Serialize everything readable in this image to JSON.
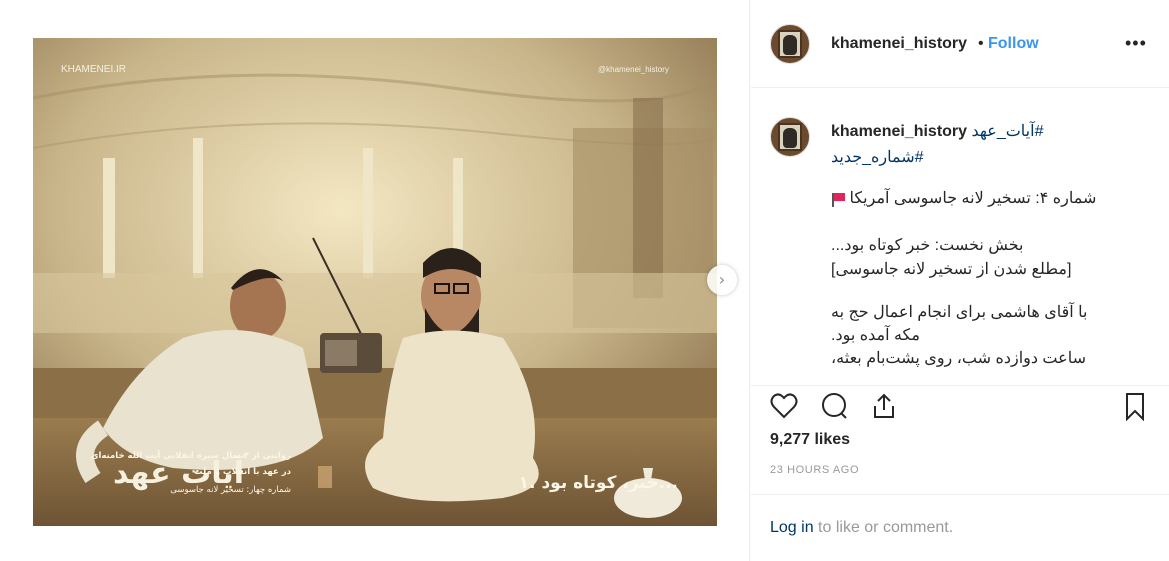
{
  "post": {
    "image_alt": "Illustration: two men seated on a rooftop, radio and tea cups; caption text in Persian",
    "image_text": {
      "logo": "KHAMENEI.IR",
      "handle": "@khamenei_history",
      "title_art": "آیات عهد",
      "subtitle_line1": "روایتی از ۴ سال سیره انقلابی آیت الله خامنه‌ای",
      "subtitle_line2": "در عهد با انقلاب و ملت",
      "subtitle_line3": "شماره چهار: تسخیر لانه جاسوسی",
      "chapter": "۱. خبر، کوتاه بود..."
    },
    "next_arrow": "›"
  },
  "header": {
    "username": "khamenei_history",
    "separator": "•",
    "follow_label": "Follow",
    "more_label": "•••"
  },
  "caption": {
    "username": "khamenei_history",
    "hashtag1": "#آیات_عهد",
    "hashtag2": "#شماره_جدید",
    "line1": "شماره ۴: تسخیر لانه جاسوسی آمریکا",
    "line2": "بخش نخست: خبر کوتاه بود...",
    "line3": "[مطلع شدن از تسخیر لانه جاسوسی]",
    "line4": "با آقای هاشمی برای انجام اعمال حج به",
    "line5": "مکه آمده بود.",
    "line6": "ساعت دوازده شب، روی پشت‌بام بعثه،"
  },
  "actions": {
    "like_icon": "heart-icon",
    "comment_icon": "comment-icon",
    "share_icon": "share-icon",
    "save_icon": "bookmark-icon"
  },
  "likes": "9,277 likes",
  "timestamp": "23 HOURS AGO",
  "comment_bar": {
    "login_label": "Log in",
    "suffix": " to like or comment."
  },
  "colors": {
    "link": "#003569",
    "follow": "#3897f0",
    "muted": "#999999",
    "text": "#262626"
  }
}
